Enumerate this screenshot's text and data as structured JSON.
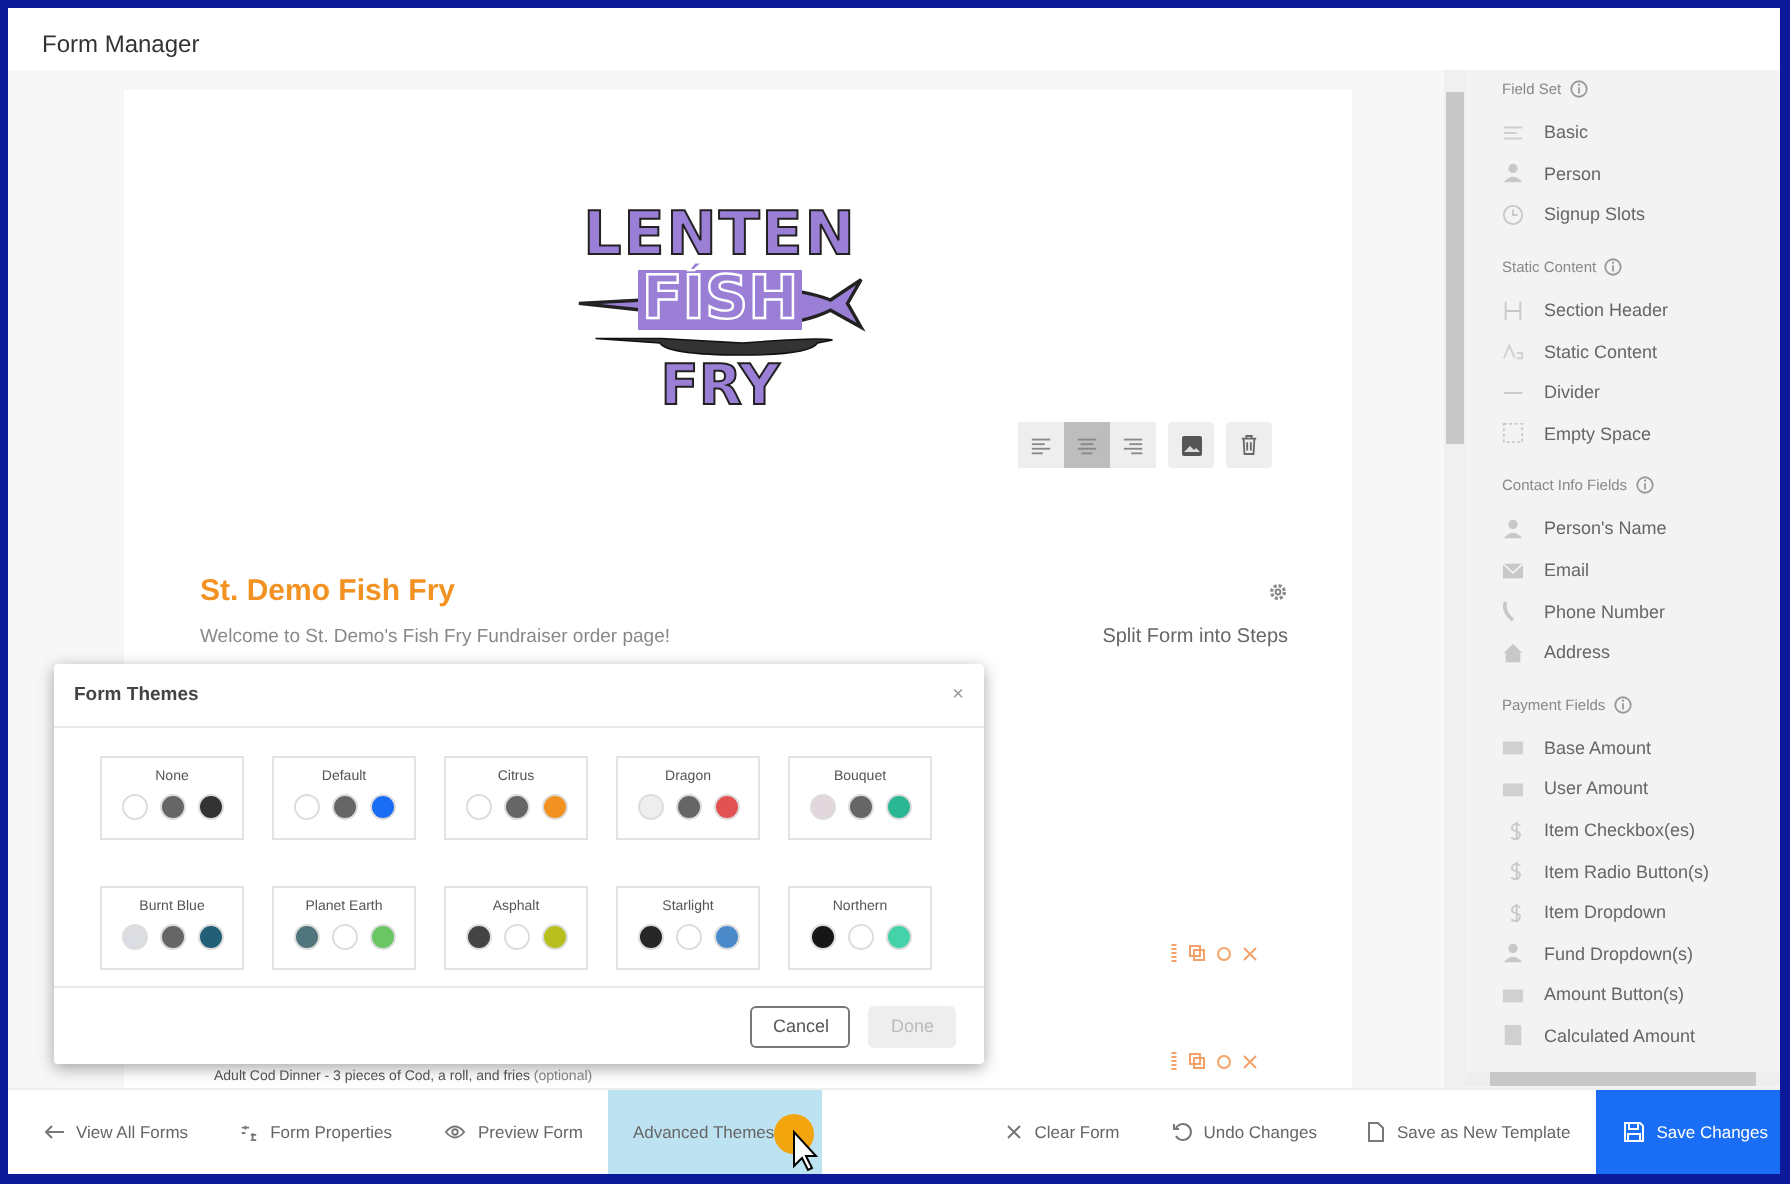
{
  "header": {
    "tab": "Form Manager"
  },
  "form": {
    "logo": {
      "lines": [
        "LENTEN",
        "FÍSH",
        "FRY"
      ]
    },
    "toolbar": {
      "align": [
        {
          "kind": "left",
          "selected": false
        },
        {
          "kind": "center",
          "selected": true
        },
        {
          "kind": "right",
          "selected": false
        }
      ]
    },
    "title": "St. Demo Fish Fry",
    "description": "Welcome to St. Demo's Fish Fry Fundraiser order page!",
    "split_link": "Split Form into Steps",
    "field_label": "Adult Cod Dinner - 3 pieces of Cod, a roll, and fries",
    "field_optional": "(optional)"
  },
  "sidebar": [
    {
      "title": "Field Set",
      "items": [
        {
          "label": "Basic",
          "kind": "lines"
        },
        {
          "label": "Person",
          "kind": "person"
        },
        {
          "label": "Signup Slots",
          "kind": "clock"
        }
      ]
    },
    {
      "title": "Static Content",
      "items": [
        {
          "label": "Section Header",
          "kind": "header"
        },
        {
          "label": "Static Content",
          "kind": "text"
        },
        {
          "label": "Divider",
          "kind": "divider"
        },
        {
          "label": "Empty Space",
          "kind": "space"
        }
      ]
    },
    {
      "title": "Contact Info Fields",
      "items": [
        {
          "label": "Person's Name",
          "kind": "person"
        },
        {
          "label": "Email",
          "kind": "mail"
        },
        {
          "label": "Phone Number",
          "kind": "phone"
        },
        {
          "label": "Address",
          "kind": "home"
        }
      ]
    },
    {
      "title": "Payment Fields",
      "items": [
        {
          "label": "Base Amount",
          "kind": "money"
        },
        {
          "label": "User Amount",
          "kind": "money"
        },
        {
          "label": "Item Checkbox(es)",
          "kind": "dollar"
        },
        {
          "label": "Item Radio Button(s)",
          "kind": "dollar"
        },
        {
          "label": "Item Dropdown",
          "kind": "dollar"
        },
        {
          "label": "Fund Dropdown(s)",
          "kind": "person"
        },
        {
          "label": "Amount Button(s)",
          "kind": "money"
        },
        {
          "label": "Calculated Amount",
          "kind": "calc"
        }
      ]
    }
  ],
  "modal": {
    "title": "Form Themes",
    "close": "×",
    "themes": [
      {
        "name": "None",
        "swatches": [
          {
            "color": "#ffffff"
          },
          {
            "color": "#666666"
          },
          {
            "color": "#333333"
          }
        ]
      },
      {
        "name": "Default",
        "swatches": [
          {
            "color": "#ffffff"
          },
          {
            "color": "#666666"
          },
          {
            "color": "#1a6ef5"
          }
        ]
      },
      {
        "name": "Citrus",
        "swatches": [
          {
            "color": "#ffffff"
          },
          {
            "color": "#666666"
          },
          {
            "color": "#f29222"
          }
        ]
      },
      {
        "name": "Dragon",
        "swatches": [
          {
            "color": "#eeeeee"
          },
          {
            "color": "#666666"
          },
          {
            "color": "#e25252"
          }
        ]
      },
      {
        "name": "Bouquet",
        "swatches": [
          {
            "color": "#e2d6dc"
          },
          {
            "color": "#666666"
          },
          {
            "color": "#2bb793"
          }
        ]
      },
      {
        "name": "Burnt Blue",
        "swatches": [
          {
            "color": "#dcdde3"
          },
          {
            "color": "#666666"
          },
          {
            "color": "#236078"
          }
        ]
      },
      {
        "name": "Planet Earth",
        "swatches": [
          {
            "color": "#51757c"
          },
          {
            "color": "#ffffff"
          },
          {
            "color": "#69c662"
          }
        ]
      },
      {
        "name": "Asphalt",
        "swatches": [
          {
            "color": "#444444"
          },
          {
            "color": "#ffffff"
          },
          {
            "color": "#b8c020"
          }
        ]
      },
      {
        "name": "Starlight",
        "swatches": [
          {
            "color": "#262626"
          },
          {
            "color": "#ffffff"
          },
          {
            "color": "#4a8acb"
          }
        ]
      },
      {
        "name": "Northern",
        "swatches": [
          {
            "color": "#161616"
          },
          {
            "color": "#ffffff"
          },
          {
            "color": "#44d2a8"
          }
        ]
      }
    ],
    "buttons": [
      {
        "label": "Cancel",
        "disabled": false
      },
      {
        "label": "Done",
        "disabled": true
      }
    ]
  },
  "bottom_bar": {
    "left": [
      {
        "label": "View All Forms",
        "kind": "back",
        "selected": false
      },
      {
        "label": "Form Properties",
        "kind": "props",
        "selected": false
      },
      {
        "label": "Preview Form",
        "kind": "eye",
        "selected": false
      },
      {
        "label": "Advanced Themes",
        "kind": "none",
        "selected": true
      }
    ],
    "right": [
      {
        "label": "Clear Form",
        "kind": "x"
      },
      {
        "label": "Undo Changes",
        "kind": "undo"
      },
      {
        "label": "Save as New Template",
        "kind": "file"
      },
      {
        "label": "Save Changes",
        "kind": "save"
      }
    ]
  }
}
